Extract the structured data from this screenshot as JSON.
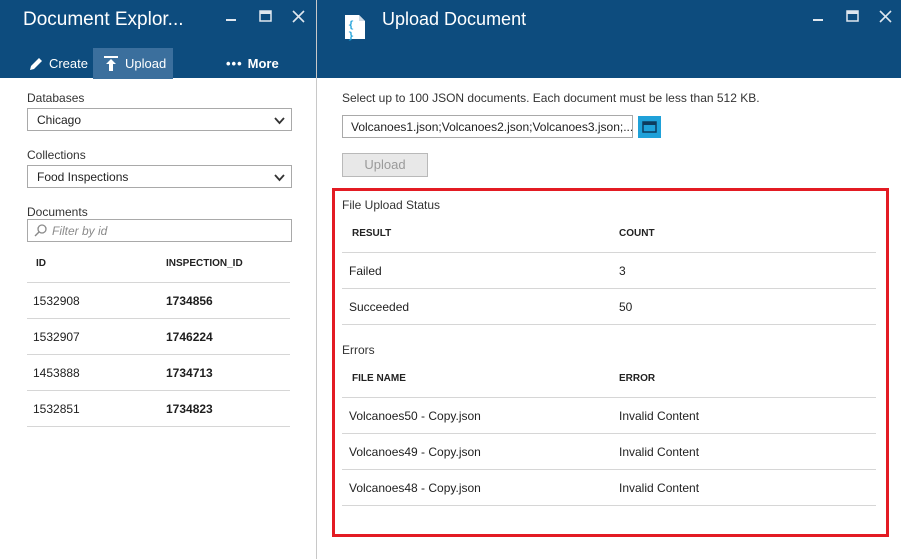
{
  "left_blade": {
    "title": "Document Explor...",
    "commands": {
      "create": "Create",
      "upload": "Upload",
      "more": "More"
    },
    "databases": {
      "label": "Databases",
      "value": "Chicago"
    },
    "collections": {
      "label": "Collections",
      "value": "Food Inspections"
    },
    "documents": {
      "label": "Documents",
      "filter_placeholder": "Filter by id",
      "columns": {
        "id": "ID",
        "inspection_id": "INSPECTION_ID"
      },
      "rows": [
        {
          "id": "1532908",
          "inspection_id": "1734856"
        },
        {
          "id": "1532907",
          "inspection_id": "1746224"
        },
        {
          "id": "1453888",
          "inspection_id": "1734713"
        },
        {
          "id": "1532851",
          "inspection_id": "1734823"
        }
      ]
    }
  },
  "right_blade": {
    "title": "Upload Document",
    "icon_glyph": "{ }",
    "instructions": "Select up to 100 JSON documents. Each document must be less than 512 KB.",
    "file_input_value": "Volcanoes1.json;Volcanoes2.json;Volcanoes3.json;...",
    "upload_label": "Upload",
    "status": {
      "title": "File Upload Status",
      "columns": {
        "result": "RESULT",
        "count": "COUNT"
      },
      "rows": [
        {
          "result": "Failed",
          "count": "3"
        },
        {
          "result": "Succeeded",
          "count": "50"
        }
      ]
    },
    "errors": {
      "title": "Errors",
      "columns": {
        "file_name": "FILE NAME",
        "error": "ERROR"
      },
      "rows": [
        {
          "file_name": "Volcanoes50 - Copy.json",
          "error": "Invalid Content"
        },
        {
          "file_name": "Volcanoes49 - Copy.json",
          "error": "Invalid Content"
        },
        {
          "file_name": "Volcanoes48 - Copy.json",
          "error": "Invalid Content"
        }
      ]
    }
  },
  "colors": {
    "header_bg": "#0d4c7e",
    "active_command_bg": "#3b6f9d",
    "browse_button": "#1fa1d9",
    "highlight_frame": "#e31b23"
  },
  "icons": {
    "create": "pencil-icon",
    "upload": "upload-icon",
    "more": "ellipsis-icon",
    "minimize": "minimize-icon",
    "maximize": "maximize-icon",
    "close": "close-icon",
    "dropdown": "chevron-down-icon",
    "search": "search-icon",
    "browse": "folder-icon",
    "document": "json-document-icon"
  }
}
